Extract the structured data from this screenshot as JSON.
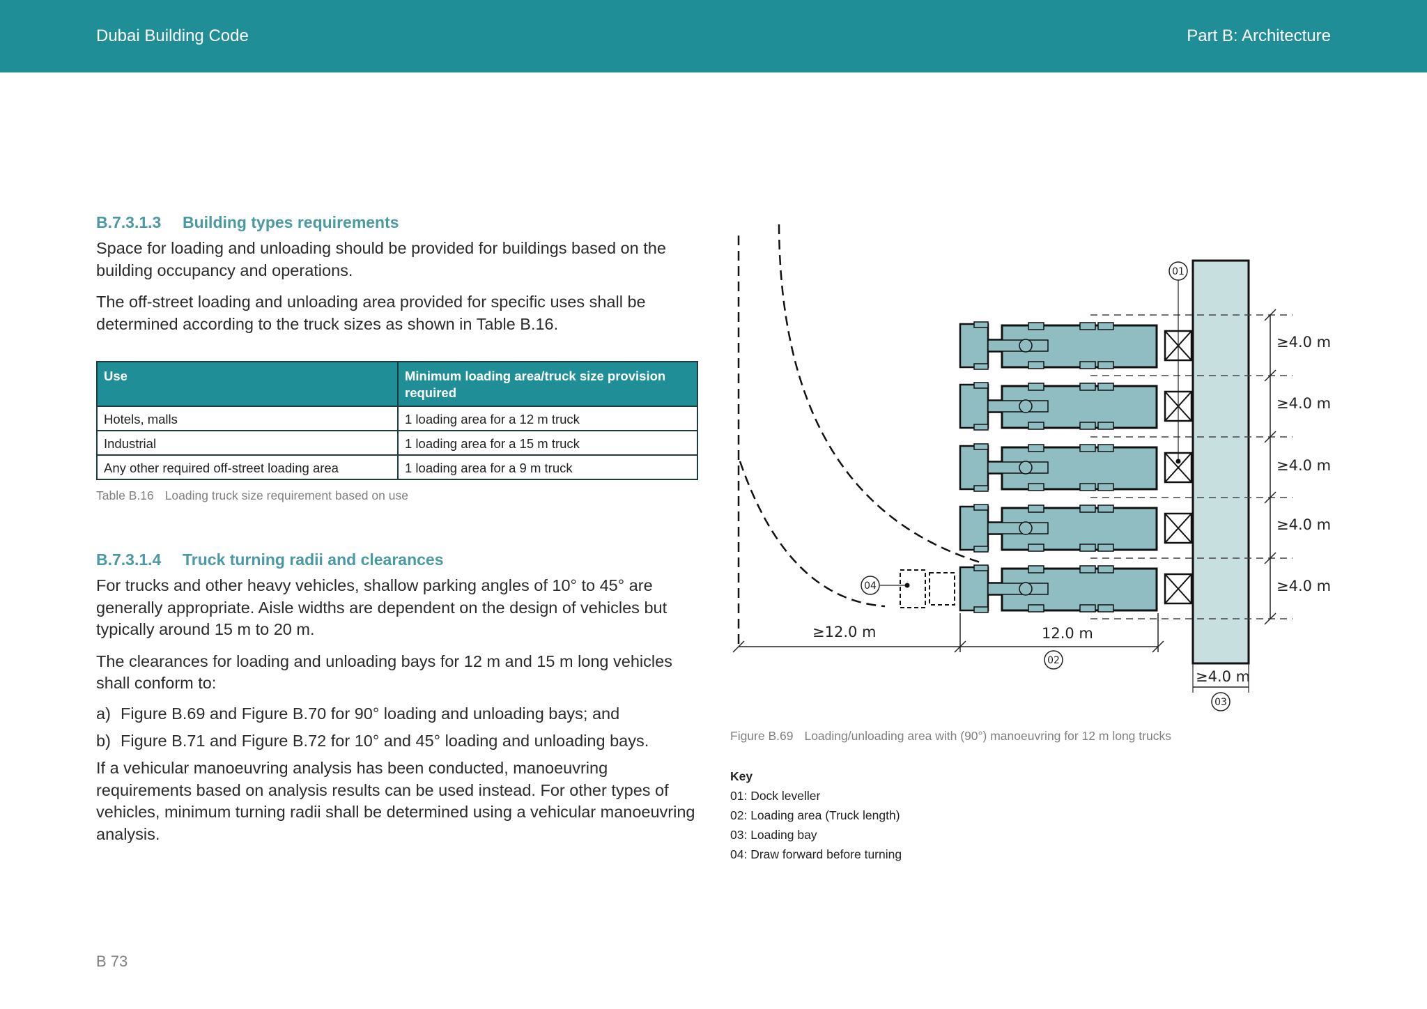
{
  "header": {
    "left": "Dubai Building Code",
    "right": "Part B: Architecture",
    "bg_color": "#208e96"
  },
  "section1": {
    "number": "B.7.3.1.3",
    "title": "Building types requirements",
    "p1": "Space for loading and unloading should be provided for buildings based on the building occupancy and operations.",
    "p2": "The off-street loading and unloading area provided for specific uses shall be determined according to the truck sizes as shown in Table B.16."
  },
  "table": {
    "headers": [
      "Use",
      "Minimum loading area/truck size provision required"
    ],
    "rows": [
      [
        "Hotels, malls",
        "1 loading area for a 12 m truck"
      ],
      [
        "Industrial",
        "1 loading area for a 15 m truck"
      ],
      [
        "Any other required off-street loading area",
        "1 loading area for a 9 m truck"
      ]
    ],
    "caption_label": "Table B.16",
    "caption_text": "Loading truck size requirement based on use"
  },
  "section2": {
    "number": "B.7.3.1.4",
    "title": "Truck turning radii and clearances",
    "p1": "For trucks and other heavy vehicles, shallow parking angles of 10° to 45° are generally appropriate. Aisle widths are dependent on the design of vehicles but typically around 15 m to 20 m.",
    "p2": "The clearances for loading and unloading bays for 12 m and 15 m long vehicles shall conform to:",
    "items": [
      {
        "marker": "a)",
        "text": "Figure B.69 and Figure B.70 for 90° loading and unloading bays; and"
      },
      {
        "marker": "b)",
        "text": "Figure B.71 and Figure B.72 for 10° and 45° loading and unloading bays."
      }
    ],
    "p3": "If a vehicular manoeuvring analysis has been conducted, manoeuvring requirements based on analysis results can be used instead. For other types of vehicles, minimum turning radii shall be determined using a vehicular manoeuvring analysis."
  },
  "figure": {
    "label": "Figure B.69",
    "caption": "Loading/unloading area with (90°) manoeuvring for 12 m long trucks",
    "dims": {
      "bay_spacing": "≥4.0 m",
      "aisle": "≥12.0 m",
      "truck_length": "12.0 m",
      "bay_depth": "≥4.0 m"
    },
    "markers": [
      "01",
      "02",
      "03",
      "04"
    ],
    "truck_count": 5,
    "truck_color": "#8fbdc2",
    "dock_color": "#c8dfe0"
  },
  "key": {
    "title": "Key",
    "items": [
      "01: Dock leveller",
      "02: Loading area (Truck length)",
      "03: Loading bay",
      "04: Draw forward before turning"
    ]
  },
  "page_number": "B 73"
}
